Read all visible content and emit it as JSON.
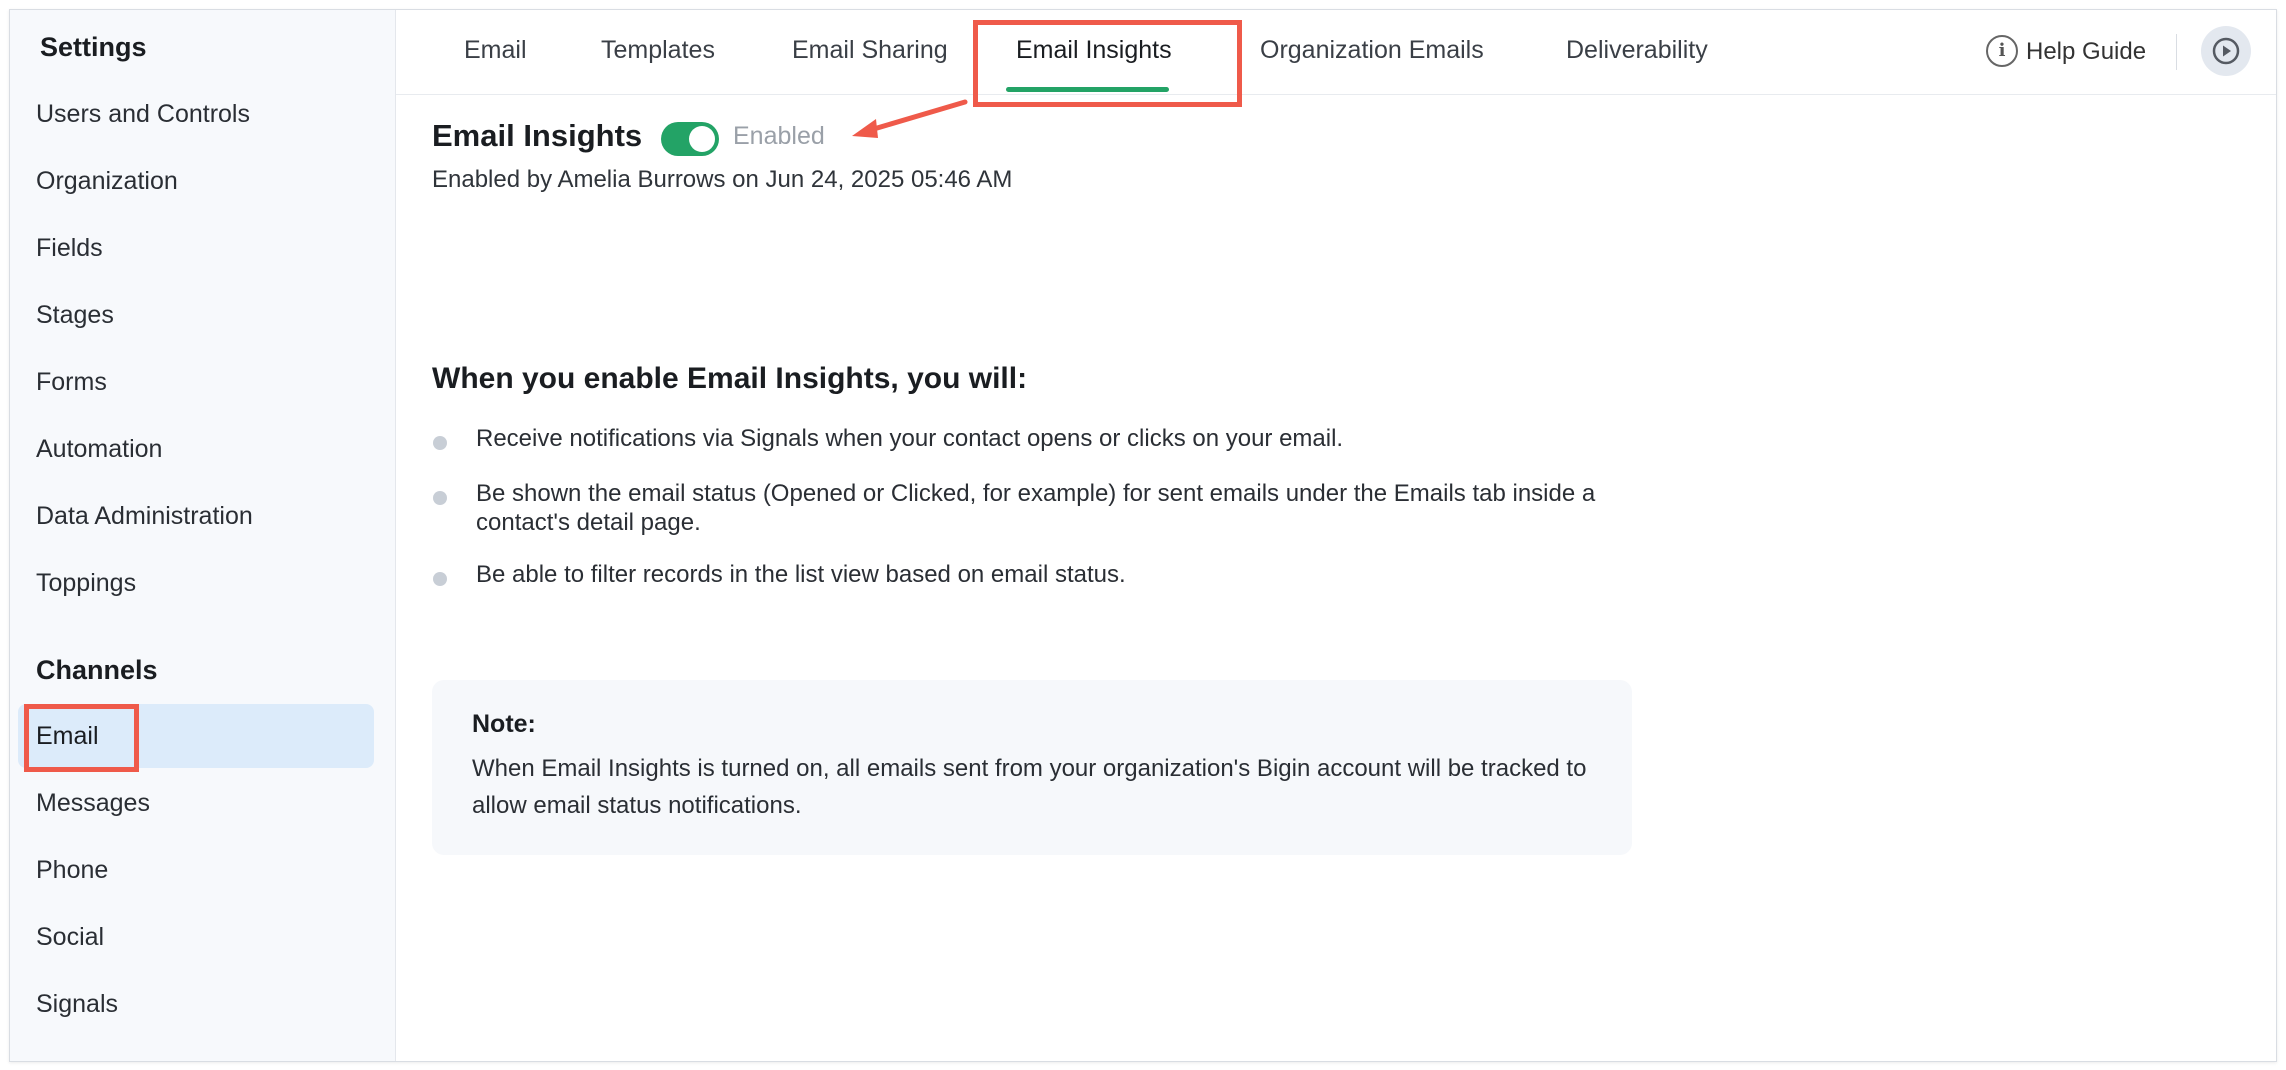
{
  "sidebar": {
    "settings_heading": "Settings",
    "settings_items": [
      {
        "label": "Users and Controls"
      },
      {
        "label": "Organization"
      },
      {
        "label": "Fields"
      },
      {
        "label": "Stages"
      },
      {
        "label": "Forms"
      },
      {
        "label": "Automation"
      },
      {
        "label": "Data Administration"
      },
      {
        "label": "Toppings"
      }
    ],
    "channels_heading": "Channels",
    "channel_items": [
      {
        "label": "Email",
        "active": true
      },
      {
        "label": "Messages"
      },
      {
        "label": "Phone"
      },
      {
        "label": "Social"
      },
      {
        "label": "Signals"
      }
    ]
  },
  "tabs": [
    {
      "label": "Email"
    },
    {
      "label": "Templates"
    },
    {
      "label": "Email Sharing"
    },
    {
      "label": "Email Insights",
      "active": true
    },
    {
      "label": "Organization Emails"
    },
    {
      "label": "Deliverability"
    }
  ],
  "header": {
    "help_label": "Help Guide",
    "help_icon": "info-icon",
    "play_icon": "play-circle-icon"
  },
  "main": {
    "title": "Email Insights",
    "toggle_status": "Enabled",
    "toggle_on": true,
    "enabled_by": "Enabled by Amelia Burrows on Jun 24, 2025 05:46 AM",
    "section_heading": "When you enable Email Insights, you will:",
    "bullets": [
      "Receive notifications via Signals when your contact opens or clicks on your email.",
      "Be shown the email status (Opened or Clicked, for example) for sent emails under the Emails tab inside a contact's detail page.",
      "Be able to filter records in the list view based on email status."
    ],
    "note": {
      "title": "Note:",
      "text": "When Email Insights is turned on, all emails sent from your organization's Bigin account will be tracked to allow email status notifications."
    }
  },
  "colors": {
    "accent_green": "#23a366",
    "active_sidebar_bg": "#dcebfa",
    "annotation_red": "#ef5a4a"
  }
}
